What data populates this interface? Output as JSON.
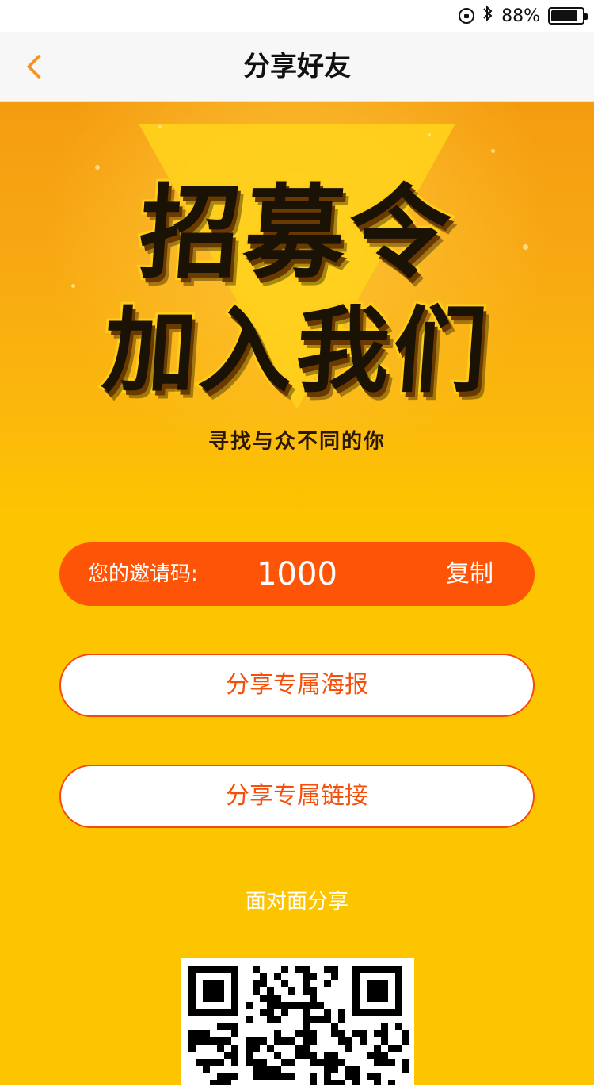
{
  "status_bar": {
    "battery_percent": "88%",
    "battery_level": 0.88
  },
  "nav": {
    "title": "分享好友"
  },
  "hero": {
    "headline_1": "招募令",
    "headline_2": "加入我们",
    "subtitle": "寻找与众不同的你"
  },
  "invite": {
    "label": "您的邀请码:",
    "code": "1000",
    "copy_label": "复制"
  },
  "actions": {
    "share_poster": "分享专属海报",
    "share_link": "分享专属链接"
  },
  "face_share": {
    "label": "面对面分享"
  },
  "colors": {
    "background": "#fdc400",
    "accent_orange": "#fd5407",
    "back_arrow": "#f6931e"
  }
}
